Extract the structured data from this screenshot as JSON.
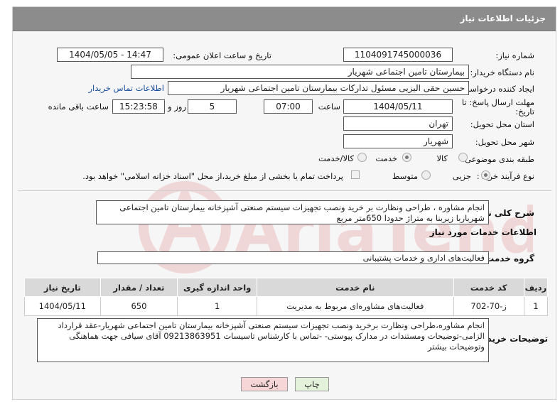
{
  "header": {
    "title": "جزئیات اطلاعات نیاز"
  },
  "fields": {
    "need_number_label": "شماره نیاز:",
    "need_number": "1104091745000036",
    "announce_label": "تاریخ و ساعت اعلان عمومی:",
    "announce_value": "1404/05/05 - 14:47",
    "buyer_org_label": "نام دستگاه خریدار:",
    "buyer_org": "بیمارستان تامین اجتماعی شهریار",
    "creator_label": "ایجاد کننده درخواست:",
    "creator": "حسین حقی الیزیی مسئول تدارکات بیمارستان تامین اجتماعی شهریار",
    "buyer_contact_link": "اطلاعات تماس خریدار",
    "deadline_label_1": "مهلت ارسال پاسخ: تا",
    "deadline_label_2": "تاریخ:",
    "deadline_date": "1404/05/11",
    "time_label": "ساعت",
    "deadline_time": "07:00",
    "days_value": "5",
    "days_label": "روز و",
    "remaining_time": "15:23:58",
    "remaining_label": "ساعت باقی مانده",
    "province_label": "استان محل تحویل:",
    "province": "تهران",
    "city_label": "شهر محل تحویل:",
    "city": "شهریار",
    "category_label": "طبقه بندی موضوعی:",
    "category_options": [
      "کالا",
      "خدمت",
      "کالا/خدمت"
    ],
    "category_selected": "خدمت",
    "process_label": "نوع فرآیند خرید :",
    "process_options": [
      "جزیی",
      "متوسط"
    ],
    "process_selected": "جزیی",
    "payment_note": "پرداخت تمام یا بخشی از مبلغ خرید،از محل \"اسناد خزانه اسلامی\" خواهد بود."
  },
  "summary": {
    "label": "شرح کلی نیاز:",
    "text": "انجام مشاوره ، طراحی ونظارت بر خرید ونصب تجهیزات سیستم صنعتی آشپزخانه بیمارستان تامین اجتماعی شهریاربا زیربنا به متراژ حدودا 650متر مربع"
  },
  "services": {
    "section_title": "اطلاعات خدمات مورد نیاز",
    "group_label": "گروه خدمت:",
    "group_value": "فعالیت‌های اداری و خدمات پشتیبانی",
    "columns": [
      "ردیف",
      "کد خدمت",
      "نام خدمت",
      "واحد اندازه گیری",
      "تعداد / مقدار",
      "تاریخ نیاز"
    ],
    "rows": [
      [
        "1",
        "ز-70-702",
        "فعالیت‌های مشاوره‌ای مربوط به مدیریت",
        "1",
        "650",
        "1404/05/11"
      ]
    ]
  },
  "buyer_notes": {
    "label": "توضیحات خریدار:",
    "text": "انجام مشاوره،طراحی ونظارت برخرید ونصب تجهیزات سیستم صنعتی آشپزخانه بیمارستان تامین اجتماعی شهریار-عقد قرارداد الزامی-توضیحات ومستندات در مدارک پیوستی-  -تماس با کارشناس تاسیسات 09213863951 آقای سیافی جهت هماهنگی وتوضیحات بیشتر"
  },
  "buttons": {
    "print": "چاپ",
    "back": "بازگشت"
  },
  "watermark_text": "AriaTender.neT",
  "colors": {
    "header": "#8c8c8c",
    "link": "#1a4fa0",
    "back_button": "#f6d6d6",
    "print_button": "#e4f2dc"
  }
}
